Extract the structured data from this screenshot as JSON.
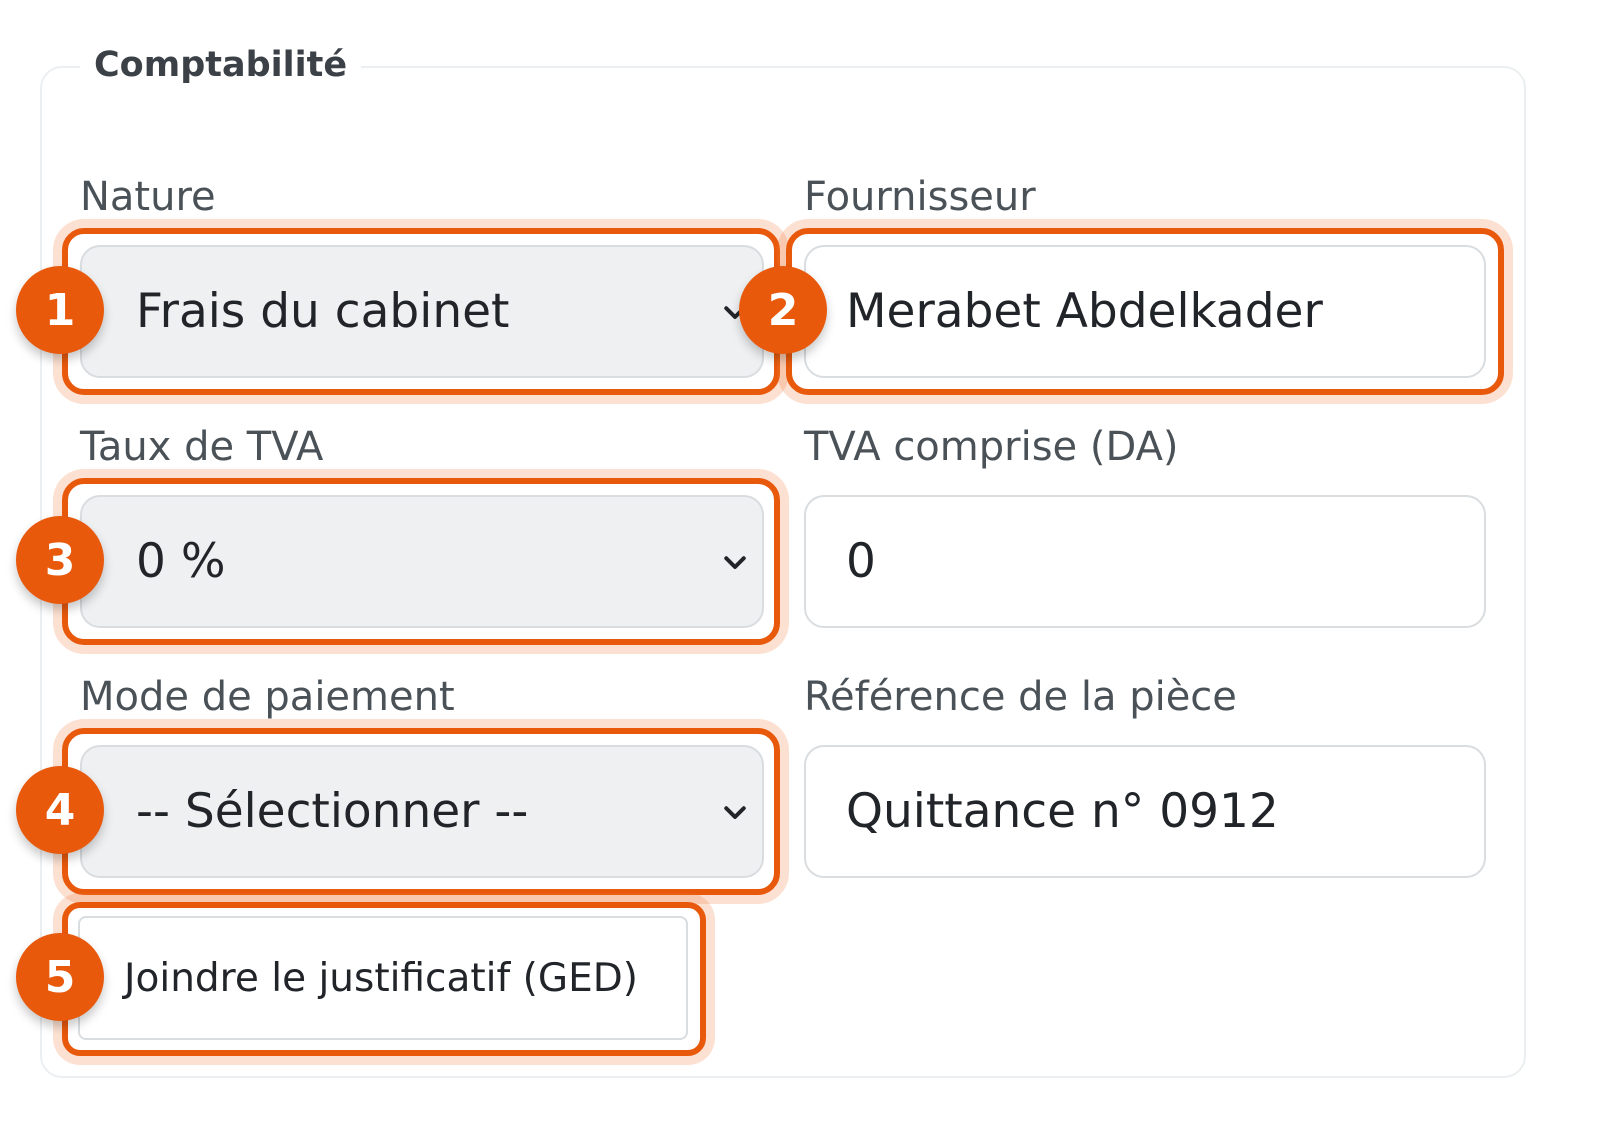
{
  "section": {
    "title": "Comptabilité"
  },
  "fields": {
    "nature": {
      "label": "Nature",
      "value": "Frais du cabinet"
    },
    "fournisseur": {
      "label": "Fournisseur",
      "value": "Merabet Abdelkader"
    },
    "taux_tva": {
      "label": "Taux de TVA",
      "value": "0 %"
    },
    "tva_comprise": {
      "label": "TVA comprise (DA)",
      "value": "0"
    },
    "mode_paiement": {
      "label": "Mode de paiement",
      "value": "-- Sélectionner --"
    },
    "reference_piece": {
      "label": "Référence de la pièce",
      "value": "Quittance n° 0912"
    }
  },
  "attach_button": {
    "label": "Joindre le justificatif (GED)"
  },
  "markers": [
    "1",
    "2",
    "3",
    "4",
    "5"
  ],
  "colors": {
    "highlight": "#e8590c",
    "select_background": "#eef0f2",
    "border": "#d9dde0"
  },
  "icons": {
    "dropdown": "chevron-down-icon"
  }
}
